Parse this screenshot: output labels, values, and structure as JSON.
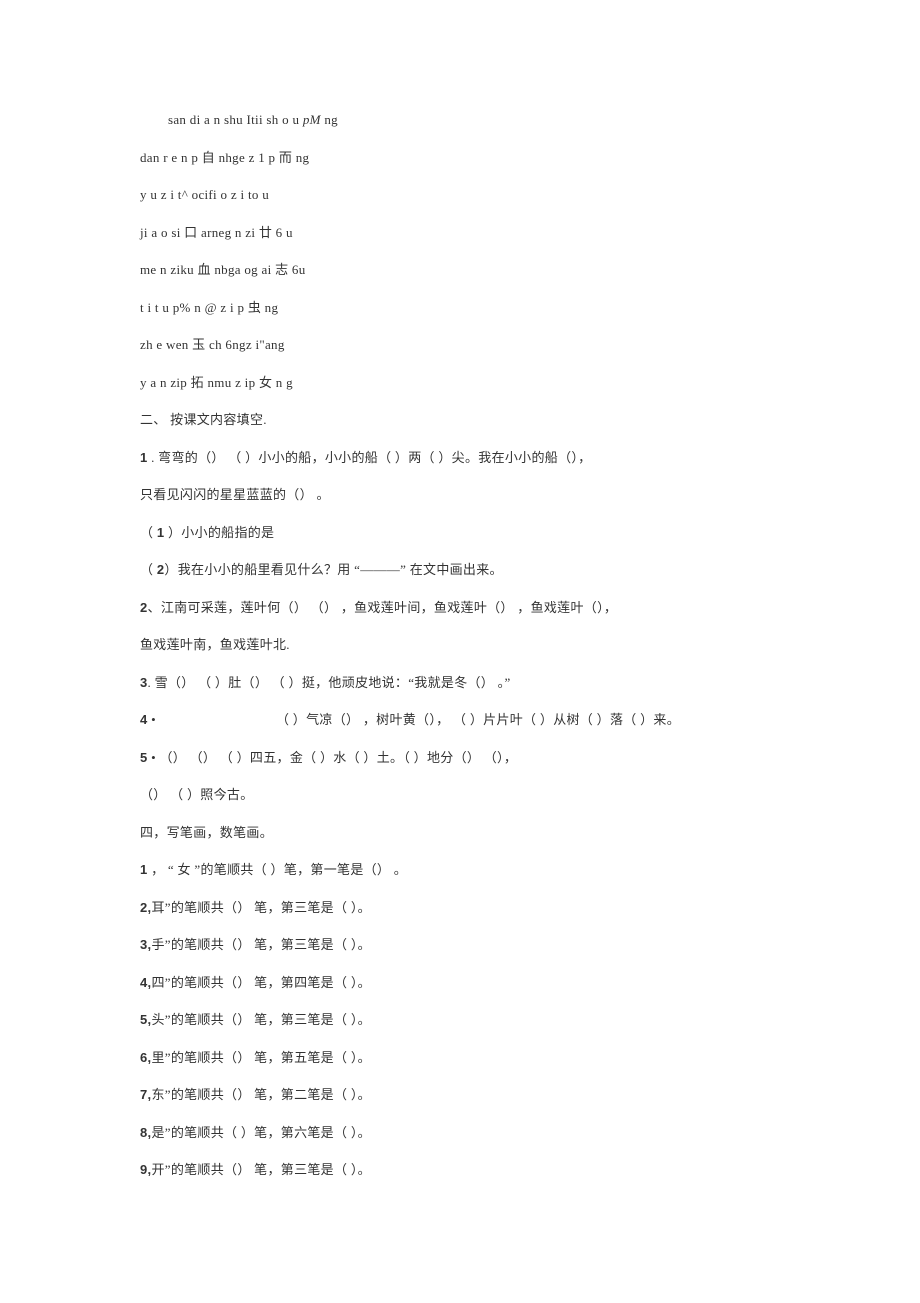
{
  "lines": [
    {
      "cls": "line indent",
      "html": "san di a n shu Itii sh o u <span class='italic'>pM</span> ng"
    },
    {
      "cls": "line",
      "html": "dan r e n p 自 nhge z 1 p 而  ng"
    },
    {
      "cls": "line",
      "html": "y u z i t^ ocifi o z i to u"
    },
    {
      "cls": "line",
      "html": "ji a o si 口 arneg n zi 廿 6 u"
    },
    {
      "cls": "line",
      "html": "me n ziku 血  nbga og ai 志 6u"
    },
    {
      "cls": "line",
      "html": "t i t u p% n @ z i p 虫 ng"
    },
    {
      "cls": "line",
      "html": "zh e wen 玉  ch 6ngz i\"ang"
    },
    {
      "cls": "line",
      "html": "y a n zip 拓  nmu z ip 女  n g"
    },
    {
      "cls": "line",
      "html": "二、 按课文内容填空."
    },
    {
      "cls": "line",
      "html": "<span class='num-strong'>1</span> . 弯弯的（）  （ ）小小的船，小小的船（ ）两（  ）尖。我在小小的船（），"
    },
    {
      "cls": "line",
      "html": "只看见闪闪的星星蓝蓝的（） 。"
    },
    {
      "cls": "line",
      "html": "（ <span class='num-strong'>1</span> ）小小的船指的是"
    },
    {
      "cls": "line",
      "html": "（ <span class='num-strong'>2</span>）我在小小的船里看见什么？用 “———” 在文中画出来。"
    },
    {
      "cls": "line",
      "html": "<span class='num-strong'>2</span>、江南可采莲，莲叶何（）  （）  ，鱼戏莲叶间，鱼戏莲叶（）  ，鱼戏莲叶（），"
    },
    {
      "cls": "line",
      "html": "鱼戏莲叶南，鱼戏莲叶北."
    },
    {
      "cls": "line",
      "html": "<span class='num-strong'>3</span>. 雪（）  （ ）肚（）  （ ）挺，他顽皮地说：“我就是冬（） 。”"
    },
    {
      "cls": "line",
      "html": "<span class='num-strong'>4</span> •<span class='gap-small'></span>（ ）气凉（）  ，树叶黄（），  （ ）片片叶（ ）从树（ ）落（ ）来。"
    },
    {
      "cls": "line",
      "html": "<span class='num-strong'>5</span> •  （）  （）  （ ）四五，金（ ）水（ ）土。（  ）地分（）  （），"
    },
    {
      "cls": "line",
      "html": "（）  （ ）照今古。"
    },
    {
      "cls": "line",
      "html": "四，写笔画，数笔画。"
    },
    {
      "cls": "line",
      "html": "<span class='num-strong'>1</span> ，  “ 女 ”的笔顺共（ ）笔，第一笔是（） 。"
    },
    {
      "cls": "line",
      "html": "<span class='num-strong'>2,</span>耳”的笔顺共（） 笔，第三笔是（ ）。"
    },
    {
      "cls": "line",
      "html": "<span class='num-strong'>3,</span>手”的笔顺共（） 笔，第三笔是（ ）。"
    },
    {
      "cls": "line",
      "html": "<span class='num-strong'>4,</span>四”的笔顺共（） 笔，第四笔是（ ）。"
    },
    {
      "cls": "line",
      "html": "<span class='num-strong'>5,</span>头”的笔顺共（） 笔，第三笔是（ ）。"
    },
    {
      "cls": "line",
      "html": "<span class='num-strong'>6,</span>里”的笔顺共（） 笔，第五笔是（ ）。"
    },
    {
      "cls": "line",
      "html": "<span class='num-strong'>7,</span>东”的笔顺共（） 笔，第二笔是（ ）。"
    },
    {
      "cls": "line",
      "html": "<span class='num-strong'>8,</span>是”的笔顺共（ ）笔，第六笔是（ ）。"
    },
    {
      "cls": "line",
      "html": "<span class='num-strong'>9,</span>开”的笔顺共（） 笔，第三笔是（ ）。"
    }
  ]
}
